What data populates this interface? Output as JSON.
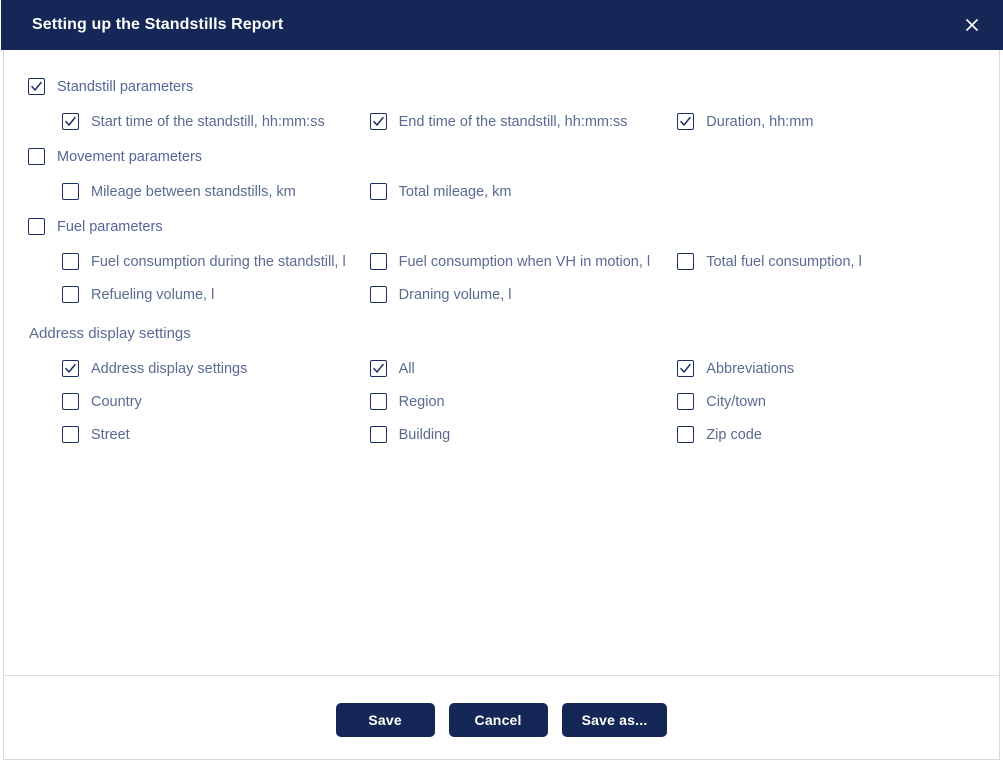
{
  "dialog": {
    "title": "Setting up the Standstills Report",
    "close_icon": "close-icon"
  },
  "colors": {
    "header_background": "#152756",
    "button_background": "#152756",
    "label_text": "#5a6a93",
    "checkbox_border": "#1e3063",
    "dialog_border": "#d9d9dd",
    "divider": "#dcdcdf"
  },
  "groups": [
    {
      "id": "standstill",
      "header": {
        "label": "Standstill parameters",
        "checked": true
      },
      "rows": [
        [
          {
            "label": "Start time of the standstill, hh:mm:ss",
            "checked": true
          },
          {
            "label": "End time of the standstill, hh:mm:ss",
            "checked": true
          },
          {
            "label": "Duration, hh:mm",
            "checked": true
          }
        ]
      ]
    },
    {
      "id": "movement",
      "header": {
        "label": "Movement parameters",
        "checked": false
      },
      "rows": [
        [
          {
            "label": "Mileage between standstills, km",
            "checked": false
          },
          {
            "label": "Total mileage, km",
            "checked": false
          },
          null
        ]
      ]
    },
    {
      "id": "fuel",
      "header": {
        "label": "Fuel parameters",
        "checked": false
      },
      "rows": [
        [
          {
            "label": "Fuel consumption during the standstill, l",
            "checked": false
          },
          {
            "label": "Fuel consumption when VH in motion, l",
            "checked": false
          },
          {
            "label": "Total fuel consumption, l",
            "checked": false
          }
        ],
        [
          {
            "label": "Refueling volume, l",
            "checked": false
          },
          {
            "label": "Draning volume, l",
            "checked": false
          },
          null
        ]
      ]
    }
  ],
  "address_section": {
    "heading": "Address display settings",
    "rows": [
      [
        {
          "label": "Address display settings",
          "checked": true
        },
        {
          "label": "All",
          "checked": true
        },
        {
          "label": "Abbreviations",
          "checked": true
        }
      ],
      [
        {
          "label": "Country",
          "checked": false
        },
        {
          "label": "Region",
          "checked": false
        },
        {
          "label": "City/town",
          "checked": false
        }
      ],
      [
        {
          "label": "Street",
          "checked": false
        },
        {
          "label": "Building",
          "checked": false
        },
        {
          "label": "Zip code",
          "checked": false
        }
      ]
    ]
  },
  "footer": {
    "buttons": [
      {
        "id": "save",
        "label": "Save"
      },
      {
        "id": "cancel",
        "label": "Cancel"
      },
      {
        "id": "save-as",
        "label": "Save as..."
      }
    ]
  }
}
